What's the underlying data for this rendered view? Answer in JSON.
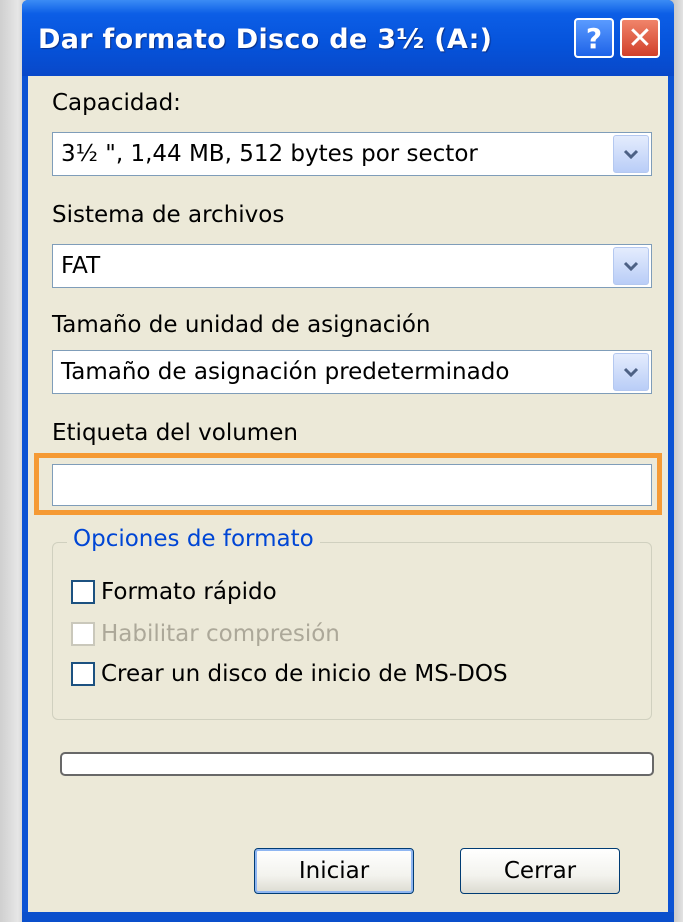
{
  "window": {
    "title": "Dar formato Disco de 3½ (A:)",
    "help_glyph": "?",
    "close_glyph": "✕"
  },
  "capacity": {
    "label": "Capacidad:",
    "value": "3½ \", 1,44 MB, 512 bytes por sector"
  },
  "filesystem": {
    "label": "Sistema de archivos",
    "value": "FAT"
  },
  "allocation": {
    "label": "Tamaño de unidad de asignación",
    "value": "Tamaño de asignación predeterminado"
  },
  "volume_label": {
    "label": "Etiqueta del volumen",
    "value": ""
  },
  "format_options": {
    "title": "Opciones de formato",
    "quick_format": "Formato rápido",
    "enable_compression": "Habilitar compresión",
    "msdos_boot_disk": "Crear un disco de inicio de MS-DOS"
  },
  "progress": {
    "value": 0
  },
  "buttons": {
    "start": "Iniciar",
    "close": "Cerrar"
  },
  "colors": {
    "titlebar": "#0654dc",
    "client_bg": "#ece9d8",
    "highlight": "#f59a34",
    "group_title": "#0046d5"
  },
  "icons": {
    "help": "help-icon",
    "close": "close-icon",
    "dropdown": "chevron-down-icon"
  }
}
